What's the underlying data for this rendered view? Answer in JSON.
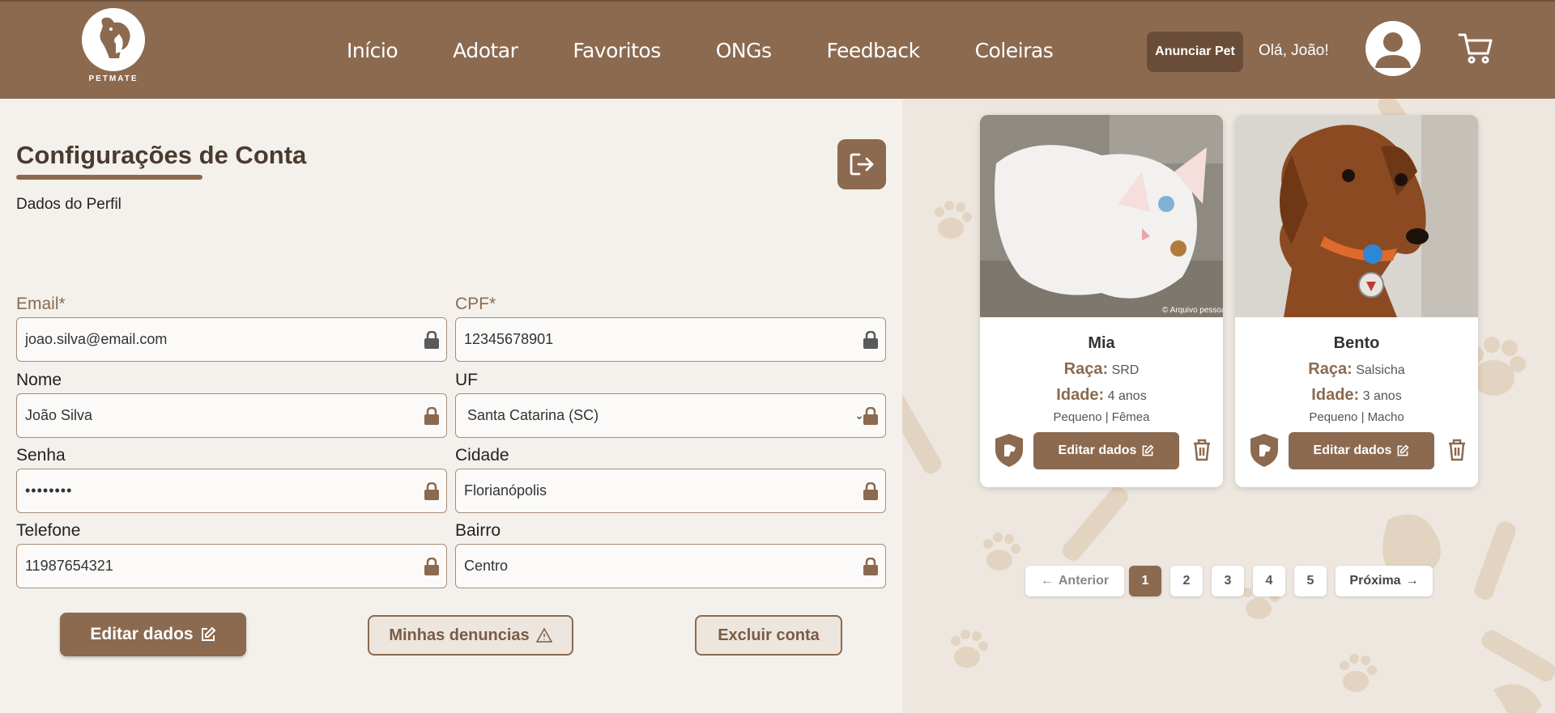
{
  "brand": {
    "name": "PETMATE"
  },
  "nav": [
    {
      "label": "Início"
    },
    {
      "label": "Adotar"
    },
    {
      "label": "Favoritos"
    },
    {
      "label": "ONGs"
    },
    {
      "label": "Feedback"
    },
    {
      "label": "Coleiras"
    }
  ],
  "header": {
    "announce_label": "Anunciar Pet",
    "greeting": "Olá, João!"
  },
  "account": {
    "title": "Configurações de Conta",
    "subtitle": "Dados do Perfil",
    "fields": {
      "email": {
        "label": "Email*",
        "value": "joao.silva@email.com"
      },
      "cpf": {
        "label": "CPF*",
        "value": "12345678901"
      },
      "nome": {
        "label": "Nome",
        "value": "João Silva"
      },
      "uf": {
        "label": "UF",
        "value": "Santa Catarina (SC)"
      },
      "senha": {
        "label": "Senha",
        "value": "••••••••"
      },
      "cidade": {
        "label": "Cidade",
        "value": "Florianópolis"
      },
      "telefone": {
        "label": "Telefone",
        "value": "11987654321"
      },
      "bairro": {
        "label": "Bairro",
        "value": "Centro"
      }
    },
    "buttons": {
      "edit": "Editar dados",
      "reports": "Minhas denuncias",
      "delete": "Excluir conta"
    }
  },
  "pets": [
    {
      "name": "Mia",
      "breed_label": "Raça:",
      "breed": "SRD",
      "age_label": "Idade:",
      "age": "4 anos",
      "details": "Pequeno | Fêmea",
      "edit_label": "Editar dados",
      "photo_credit": "© Arquivo pessoal"
    },
    {
      "name": "Bento",
      "breed_label": "Raça:",
      "breed": "Salsicha",
      "age_label": "Idade:",
      "age": "3 anos",
      "details": "Pequeno | Macho",
      "edit_label": "Editar dados"
    }
  ],
  "pagination": {
    "prev": "Anterior",
    "next": "Próxima",
    "pages": [
      "1",
      "2",
      "3",
      "4",
      "5"
    ],
    "current": "1"
  },
  "colors": {
    "primary": "#8b6a50",
    "dark": "#6a4d38",
    "background": "#f4f1ec"
  }
}
